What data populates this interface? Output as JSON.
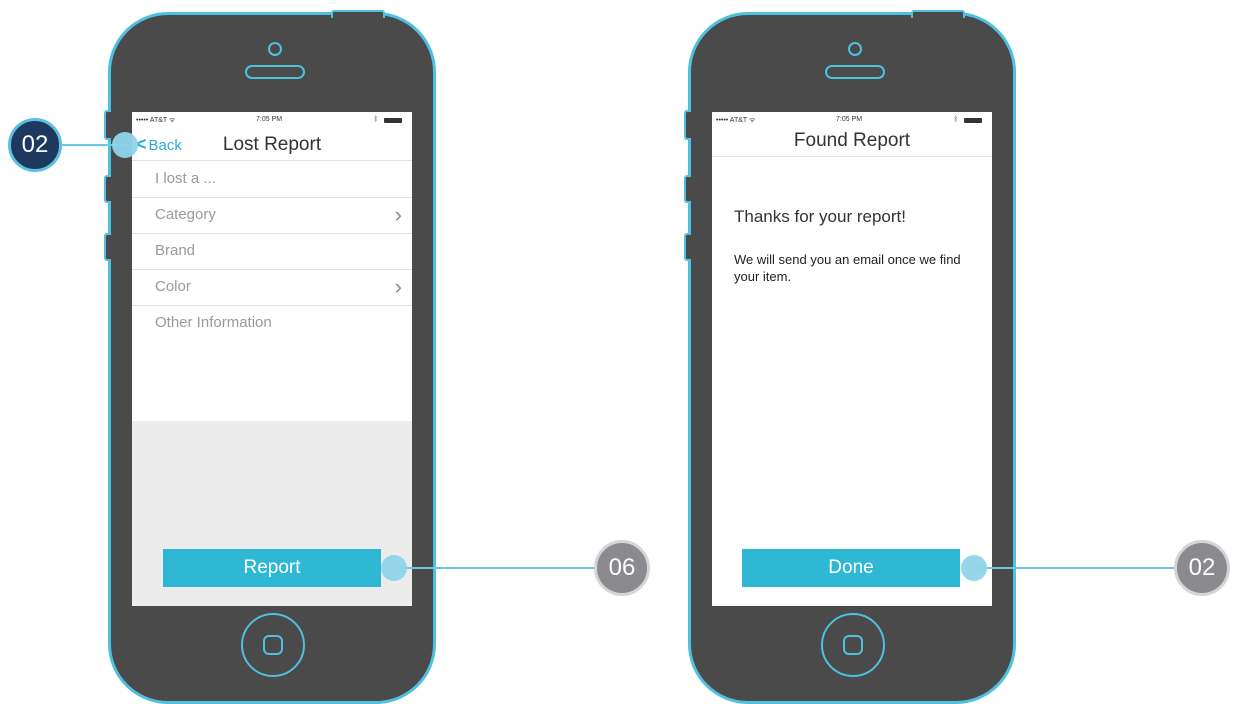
{
  "lost_screen": {
    "status": {
      "carrier": "••••• AT&T ᯤ",
      "time": "7:05 PM"
    },
    "back_label": "Back",
    "title": "Lost Report",
    "fields": [
      {
        "label": "I lost a ...",
        "has_chevron": false
      },
      {
        "label": "Category",
        "has_chevron": true
      },
      {
        "label": "Brand",
        "has_chevron": false
      },
      {
        "label": "Color",
        "has_chevron": true
      },
      {
        "label": "Other Information",
        "has_chevron": false
      }
    ],
    "report_button": "Report"
  },
  "found_screen": {
    "status": {
      "carrier": "••••• AT&T ᯤ",
      "time": "7:05 PM"
    },
    "title": "Found Report",
    "thanks": "Thanks for your report!",
    "message": "We will send you an email once we find your item.",
    "done_button": "Done"
  },
  "callouts": {
    "back": "02",
    "report": "06",
    "done": "02"
  },
  "colors": {
    "accent": "#2fb8d3",
    "phone_body": "#4a4a4a",
    "badge_dark": "#1d3a5e",
    "badge_gray": "#8a8a8f"
  }
}
